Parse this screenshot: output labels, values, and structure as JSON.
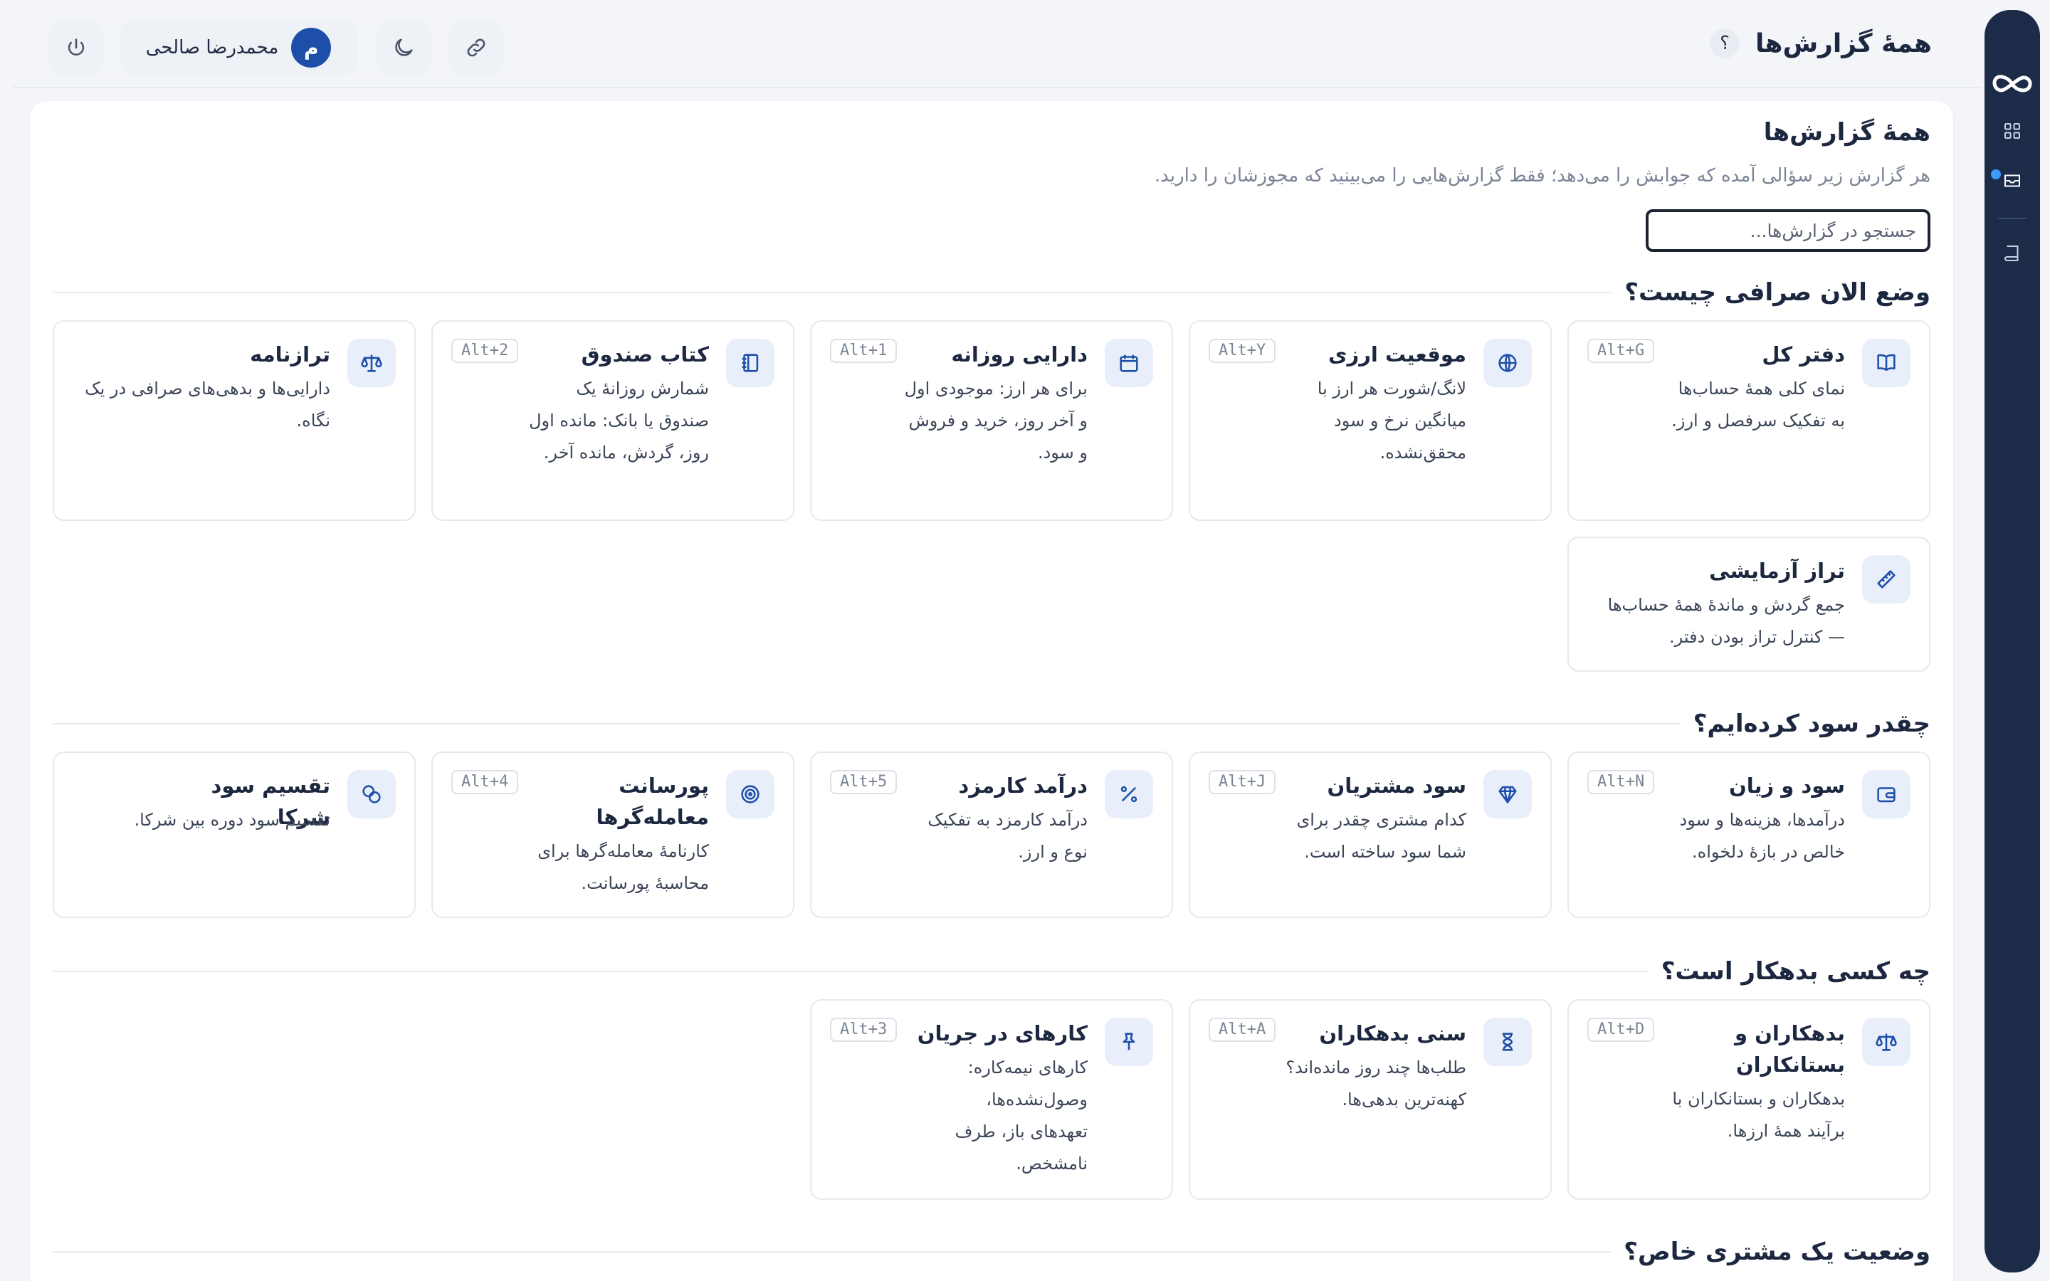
{
  "header": {
    "title": "همهٔ گزارش‌ها",
    "help": "؟",
    "user": {
      "initial": "م",
      "name": "محمدرضا صالحی"
    }
  },
  "panel": {
    "title": "همهٔ گزارش‌ها",
    "subtitle": "هر گزارش زیر سؤالی آمده که جوابش را می‌دهد؛ فقط گزارش‌هایی را می‌بینید که مجوزشان را دارید.",
    "search_placeholder": "جستجو در گزارش‌ها..."
  },
  "sections": [
    {
      "title": "وضع الان صرافی چیست؟",
      "cards": [
        {
          "title": "دفتر کل",
          "desc": "نمای کلی همهٔ حساب‌ها به تفکیک سرفصل و ارز.",
          "key": "Alt+G",
          "icon": "book-icon"
        },
        {
          "title": "موقعیت ارزی",
          "desc": "لانگ/شورت هر ارز با میانگین نرخ و سود محقق‌نشده.",
          "key": "Alt+Y",
          "icon": "globe-icon"
        },
        {
          "title": "دارایی روزانه",
          "desc": "برای هر ارز: موجودی اول و آخر روز، خرید و فروش و سود.",
          "key": "Alt+1",
          "icon": "calendar-icon"
        },
        {
          "title": "کتاب صندوق",
          "desc": "شمارش روزانهٔ یک صندوق یا بانک: مانده اول روز، گردش، مانده آخر.",
          "key": "Alt+2",
          "icon": "notebook-icon"
        },
        {
          "title": "ترازنامه",
          "desc": "دارایی‌ها و بدهی‌های صرافی در یک نگاه.",
          "key": "",
          "icon": "scale-icon"
        },
        {
          "title": "تراز آزمایشی",
          "desc": "جمع گردش و ماندهٔ همهٔ حساب‌ها — کنترل تراز بودن دفتر.",
          "key": "",
          "icon": "ruler-icon"
        }
      ]
    },
    {
      "title": "چقدر سود کرده‌ایم؟",
      "cards": [
        {
          "title": "سود و زیان",
          "desc": "درآمدها، هزینه‌ها و سود خالص در بازهٔ دلخواه.",
          "key": "Alt+N",
          "icon": "wallet-icon"
        },
        {
          "title": "سود مشتریان",
          "desc": "کدام مشتری چقدر برای شما سود ساخته است.",
          "key": "Alt+J",
          "icon": "diamond-icon"
        },
        {
          "title": "درآمد کارمزد",
          "desc": "درآمد کارمزد به تفکیک نوع و ارز.",
          "key": "Alt+5",
          "icon": "percent-icon"
        },
        {
          "title": "پورسانت معامله‌گرها",
          "desc": "کارنامهٔ معامله‌گرها برای محاسبهٔ پورسانت.",
          "key": "Alt+4",
          "icon": "target-icon"
        },
        {
          "title": "تقسیم سود شرکا",
          "desc": "تقسیم سود دوره بین شرکا.",
          "key": "",
          "icon": "coins-icon"
        }
      ]
    },
    {
      "title": "چه کسی بدهکار است؟",
      "cards": [
        {
          "title": "بدهکاران و بستانکاران",
          "desc": "بدهکاران و بستانکاران با برآیند همهٔ ارزها.",
          "key": "Alt+D",
          "icon": "scale-icon"
        },
        {
          "title": "سنی بدهکاران",
          "desc": "طلب‌ها چند روز مانده‌اند؟ کهنه‌ترین بدهی‌ها.",
          "key": "Alt+A",
          "icon": "hourglass-icon"
        },
        {
          "title": "کارهای در جریان",
          "desc": "کارهای نیمه‌کاره: وصول‌نشده‌ها، تعهدهای باز، طرف نامشخص.",
          "key": "Alt+3",
          "icon": "pin-icon"
        }
      ]
    },
    {
      "title": "وضعیت یک مشتری خاص؟",
      "cards": []
    }
  ]
}
